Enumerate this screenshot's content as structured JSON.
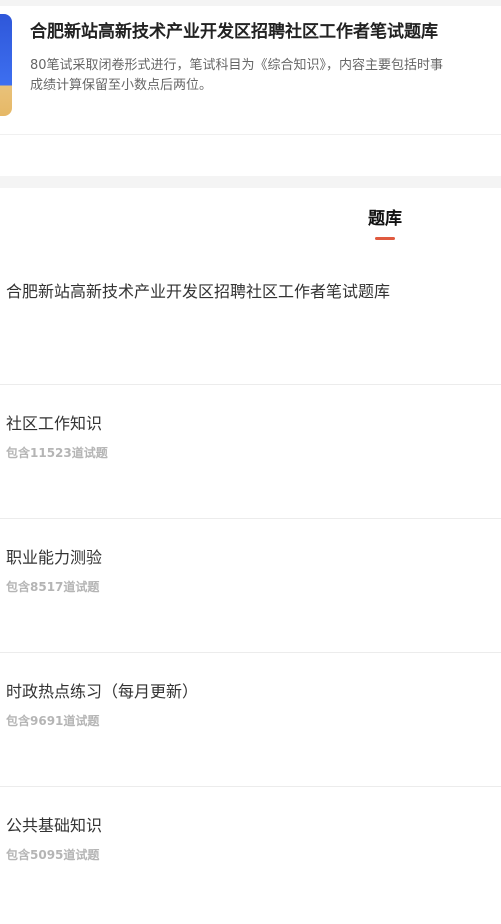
{
  "header": {
    "title": "合肥新站高新技术产业开发区招聘社区工作者笔试题库",
    "desc_line1": "80笔试采取闭卷形式进行，笔试科目为《综合知识》，内容主要包括时事",
    "desc_line2": "成绩计算保留至小数点后两位。"
  },
  "tabs": [
    {
      "label": "题库",
      "active": true
    }
  ],
  "bank": {
    "title": "合肥新站高新技术产业开发区招聘社区工作者笔试题库"
  },
  "subjects": [
    {
      "name": "社区工作知识",
      "count": "包含11523道试题"
    },
    {
      "name": "职业能力测验",
      "count": "包含8517道试题"
    },
    {
      "name": "时政热点练习（每月更新）",
      "count": "包含9691道试题"
    },
    {
      "name": "公共基础知识",
      "count": "包含5095道试题"
    }
  ],
  "colors": {
    "accent": "#e05a3f",
    "thumb_blue": "#3d6ff0",
    "muted": "#b5b5b5"
  }
}
